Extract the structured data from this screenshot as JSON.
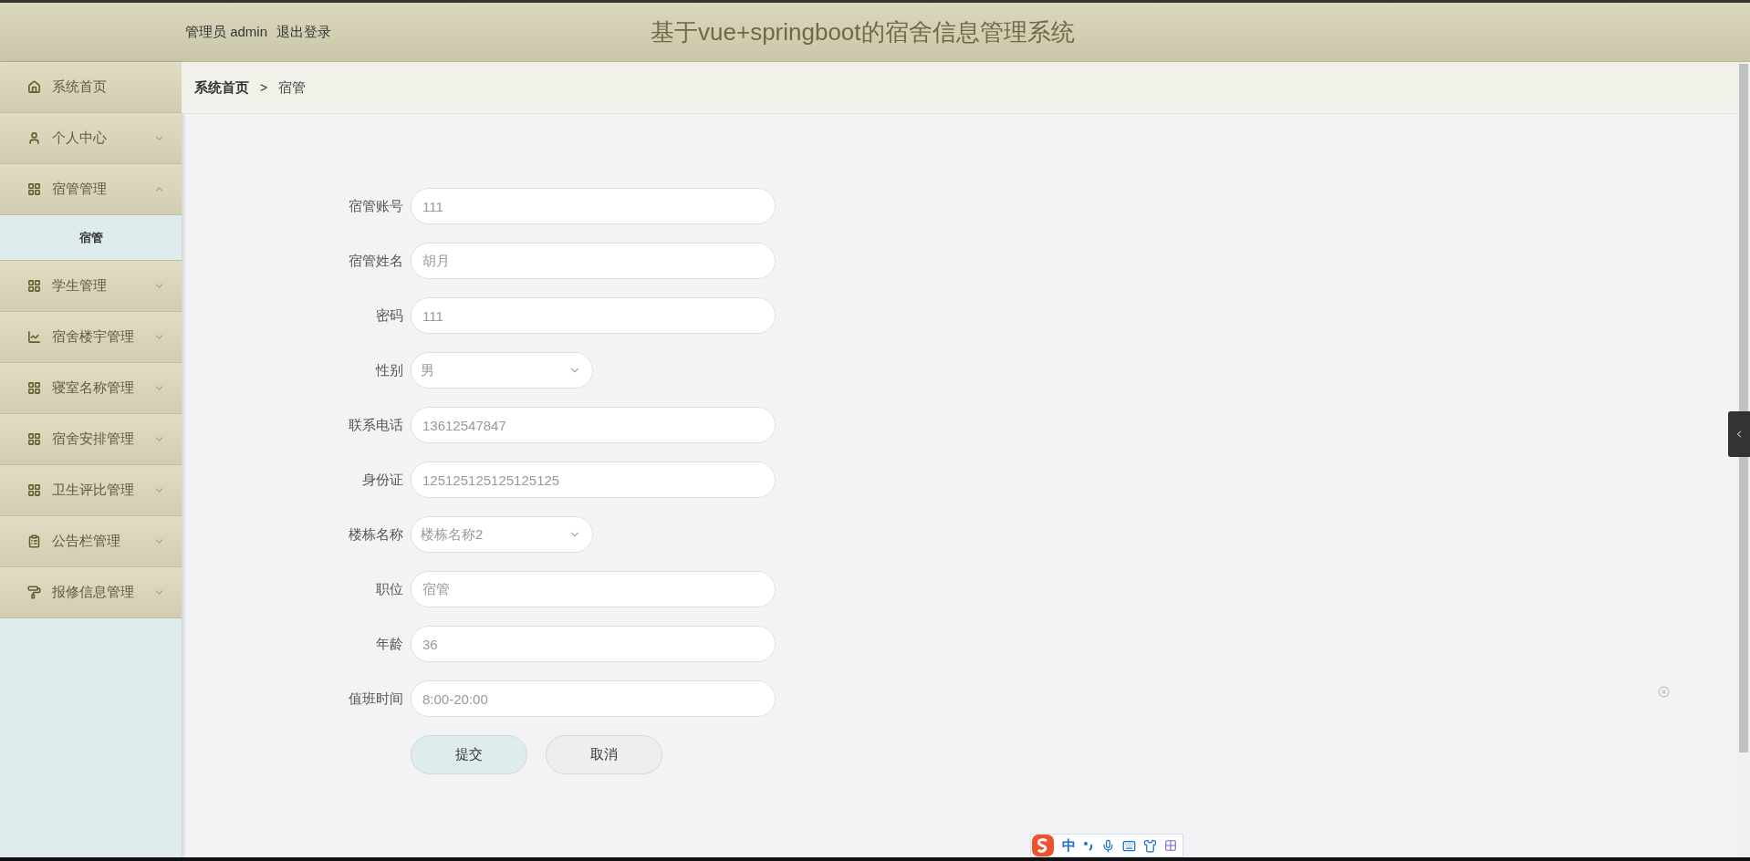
{
  "header": {
    "user_label": "管理员 admin",
    "logout": "退出登录",
    "title": "基于vue+springboot的宿舍信息管理系统"
  },
  "sidebar": {
    "items": [
      {
        "label": "系统首页",
        "kind": "home"
      },
      {
        "label": "个人中心",
        "kind": "user",
        "expanded": false
      },
      {
        "label": "宿管管理",
        "kind": "grid",
        "expanded": true,
        "children": [
          {
            "label": "宿管",
            "selected": true
          }
        ]
      },
      {
        "label": "学生管理",
        "kind": "grid",
        "expanded": false
      },
      {
        "label": "宿舍楼宇管理",
        "kind": "chart",
        "expanded": false
      },
      {
        "label": "寝室名称管理",
        "kind": "grid",
        "expanded": false
      },
      {
        "label": "宿舍安排管理",
        "kind": "grid",
        "expanded": false
      },
      {
        "label": "卫生评比管理",
        "kind": "grid",
        "expanded": false
      },
      {
        "label": "公告栏管理",
        "kind": "clipboard",
        "expanded": false
      },
      {
        "label": "报修信息管理",
        "kind": "roller",
        "expanded": false
      }
    ]
  },
  "breadcrumb": [
    "系统首页",
    "宿管"
  ],
  "breadcrumb_separator": ">",
  "form": {
    "fields": [
      {
        "label": "宿管账号",
        "kind": "text",
        "value": "111"
      },
      {
        "label": "宿管姓名",
        "kind": "text",
        "value": "胡月"
      },
      {
        "label": "密码",
        "kind": "text",
        "value": "111"
      },
      {
        "label": "性别",
        "kind": "select",
        "value": "男"
      },
      {
        "label": "联系电话",
        "kind": "text",
        "value": "13612547847"
      },
      {
        "label": "身份证",
        "kind": "text",
        "value": "125125125125125125"
      },
      {
        "label": "楼栋名称",
        "kind": "select",
        "value": "楼栋名称2"
      },
      {
        "label": "职位",
        "kind": "text",
        "value": "宿管"
      },
      {
        "label": "年龄",
        "kind": "text",
        "value": "36"
      },
      {
        "label": "值班时间",
        "kind": "text",
        "value": "8:00-20:00"
      }
    ],
    "buttons": [
      {
        "label": "提交",
        "kind": "primary"
      },
      {
        "label": "取消",
        "kind": "default"
      }
    ]
  },
  "ime_toolbar": {
    "mode": "中"
  }
}
